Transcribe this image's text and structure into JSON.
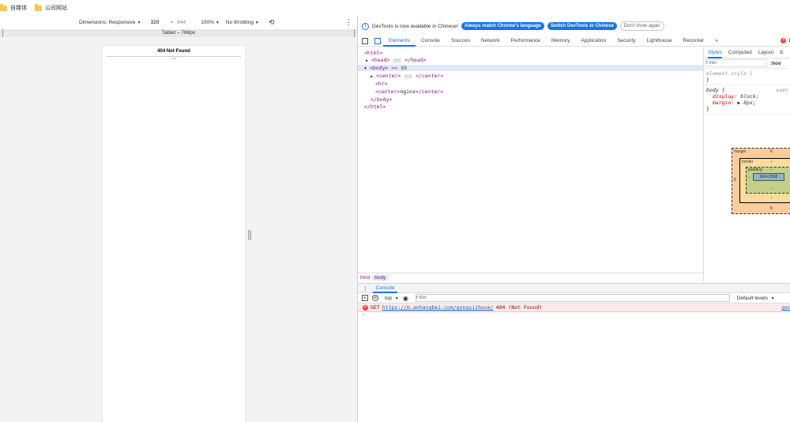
{
  "bookmarks": [
    {
      "label": "自媒体",
      "icon": "folder-icon"
    },
    {
      "label": "公司网站",
      "icon": "folder-icon"
    }
  ],
  "device_toolbar": {
    "dimensions_label": "Dimensions: Responsive",
    "width": "320",
    "times": "×",
    "height": "844",
    "zoom": "100%",
    "throttling": "No throttling",
    "rotate_icon": "rotate-icon",
    "menu_icon": "⋮"
  },
  "media_query": {
    "label": "Tablet – 768px"
  },
  "page": {
    "heading": "404 Not Found",
    "footer": "nginx"
  },
  "devtools": {
    "infobar": {
      "message": "DevTools is now available in Chinese!",
      "btn_match": "Always match Chrome's language",
      "btn_switch": "Switch DevTools to Chinese",
      "btn_dismiss": "Don't show again"
    },
    "tabs": [
      "Elements",
      "Console",
      "Sources",
      "Network",
      "Performance",
      "Memory",
      "Application",
      "Security",
      "Lighthouse",
      "Recorder"
    ],
    "active_tab": "Elements",
    "more_tabs": "»",
    "error_count": "1",
    "elements": {
      "html_open": "<html>",
      "head": "<head>",
      "head_close": "</head>",
      "body_open": "<body>",
      "body_eq": "== $0",
      "center1_open": "<center>",
      "center1_close": "</center>",
      "hr": "<hr>",
      "center2_open": "<center>",
      "center2_text": "nginx",
      "center2_close": "</center>",
      "body_close": "</body>",
      "html_close": "</html>",
      "ellipsis": "···"
    },
    "breadcrumbs": [
      "html",
      "body"
    ],
    "styles": {
      "tabs": [
        "Styles",
        "Computed",
        "Layout",
        "E"
      ],
      "filter_placeholder": "Filter",
      "hov": ":hov",
      "element_style": "element.style {",
      "close_brace": "}",
      "body_selector": "body {",
      "body_source": "user",
      "prop1": "display",
      "val1": "block;",
      "prop2": "margin",
      "val2": "▶ 8px;"
    },
    "box_model": {
      "margin_label": "margin",
      "margin_value": "8",
      "border_label": "border",
      "border_value": "–",
      "padding_label": "padding",
      "padding_value": "–",
      "content": "964×2568",
      "left_margin": "8",
      "bottom_dash": "–",
      "bottom_margin": "8"
    },
    "console": {
      "drawer_tab": "Console",
      "context": "top",
      "filter_placeholder": "Filter",
      "levels": "Default levels",
      "error_method": "GET",
      "error_url": "https://m.anhangbei.com/gongsizhuce/",
      "error_status": "404 (Not Found)",
      "error_source": "gon",
      "prompt": "›"
    }
  }
}
